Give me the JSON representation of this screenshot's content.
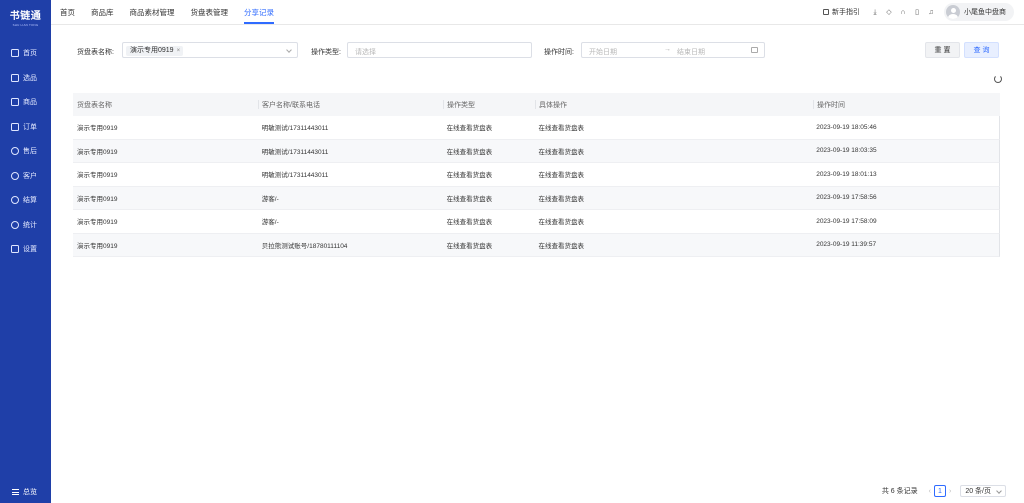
{
  "app": {
    "logo_main": "书链通",
    "logo_sub": "SHU LIAN TONG"
  },
  "sidebar": {
    "items": [
      {
        "label": "首页",
        "icon": "monitor-icon"
      },
      {
        "label": "选品",
        "icon": "select-icon"
      },
      {
        "label": "商品",
        "icon": "goods-icon"
      },
      {
        "label": "订单",
        "icon": "order-icon"
      },
      {
        "label": "售后",
        "icon": "headset-icon"
      },
      {
        "label": "客户",
        "icon": "customer-icon"
      },
      {
        "label": "结算",
        "icon": "settlement-icon"
      },
      {
        "label": "统计",
        "icon": "clock-icon"
      },
      {
        "label": "设置",
        "icon": "settings-icon"
      }
    ],
    "footer_label": "总览"
  },
  "topbar": {
    "tabs": [
      "首页",
      "商品库",
      "商品素材管理",
      "货盘表管理",
      "分享记录"
    ],
    "active_tab": "分享记录",
    "guide_label": "新手指引",
    "user_name": "小尾鱼中盘商"
  },
  "filters": {
    "sheet_label": "货盘表名称:",
    "sheet_tag": "演示专用0919",
    "op_type_label": "操作类型:",
    "op_type_placeholder": "请选择",
    "op_time_label": "操作时间:",
    "start_placeholder": "开始日期",
    "end_placeholder": "结束日期",
    "reset_label": "重 置",
    "query_label": "查 询"
  },
  "table": {
    "columns": [
      "货盘表名称",
      "客户名称/联系电话",
      "操作类型",
      "具体操作",
      "操作时间"
    ],
    "rows": [
      [
        "演示专用0919",
        "明敏测试/17311443011",
        "在线查看货盘表",
        "在线查看货盘表",
        "2023-09-19 18:05:46"
      ],
      [
        "演示专用0919",
        "明敏测试/17311443011",
        "在线查看货盘表",
        "在线查看货盘表",
        "2023-09-19 18:03:35"
      ],
      [
        "演示专用0919",
        "明敏测试/17311443011",
        "在线查看货盘表",
        "在线查看货盘表",
        "2023-09-19 18:01:13"
      ],
      [
        "演示专用0919",
        "游客/-",
        "在线查看货盘表",
        "在线查看货盘表",
        "2023-09-19 17:58:56"
      ],
      [
        "演示专用0919",
        "游客/-",
        "在线查看货盘表",
        "在线查看货盘表",
        "2023-09-19 17:58:09"
      ],
      [
        "演示专用0919",
        "贝拉熊测试账号/18780111104",
        "在线查看货盘表",
        "在线查看货盘表",
        "2023-09-19 11:39:57"
      ]
    ]
  },
  "pagination": {
    "total_text": "共 6 条记录",
    "current_page": "1",
    "page_size": "20 条/页"
  }
}
